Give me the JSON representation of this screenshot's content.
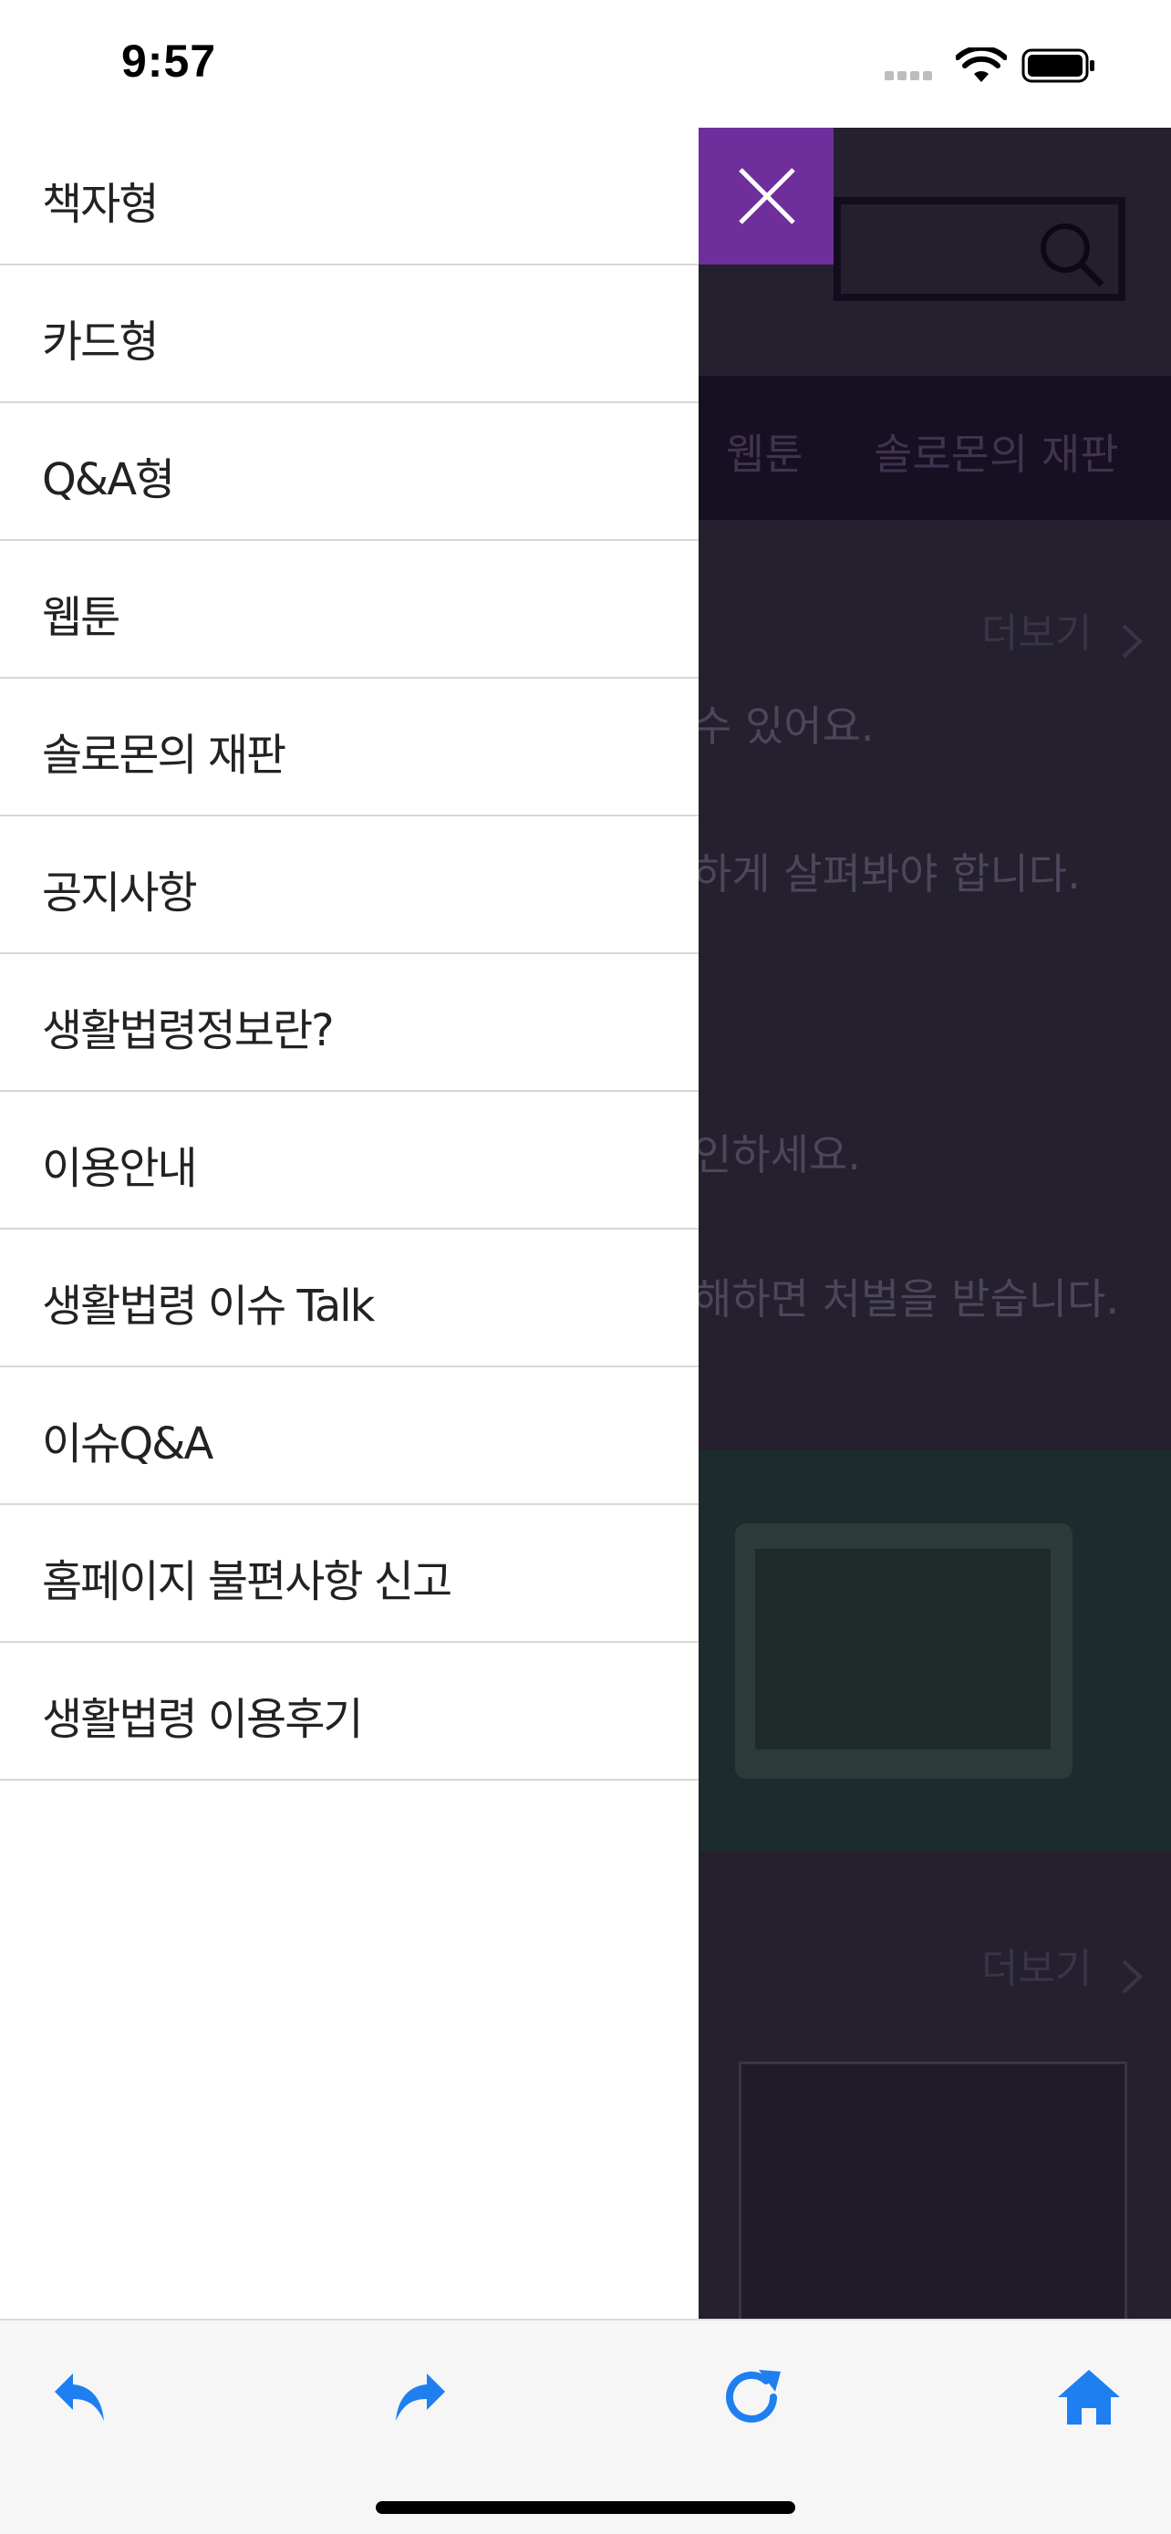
{
  "status_bar": {
    "time": "9:57"
  },
  "drawer": {
    "items": [
      {
        "label": "책자형"
      },
      {
        "label": "카드형"
      },
      {
        "label": "Q&A형"
      },
      {
        "label": "웹툰"
      },
      {
        "label": "솔로몬의 재판"
      },
      {
        "label": "공지사항"
      },
      {
        "label": "생활법령정보란?"
      },
      {
        "label": "이용안내"
      },
      {
        "label": "생활법령 이슈 Talk"
      },
      {
        "label": "이슈Q&A"
      },
      {
        "label": "홈페이지 불편사항 신고"
      },
      {
        "label": "생활법령 이용후기"
      }
    ]
  },
  "background": {
    "nav": [
      "웹툰",
      "솔로몬의 재판"
    ],
    "more_label": "더보기",
    "lines": [
      "수 있어요.",
      "하게 살펴봐야 합니다.",
      "인하세요.",
      "해하면 처벌을 받습니다."
    ]
  },
  "colors": {
    "accent_purple": "#6e2f9c",
    "toolbar_icon_blue": "#1e7ff0",
    "overlay": "#24202e"
  },
  "toolbar": {
    "icons": [
      "back-arrow-icon",
      "forward-arrow-icon",
      "reload-icon",
      "home-icon"
    ]
  }
}
